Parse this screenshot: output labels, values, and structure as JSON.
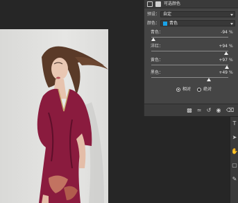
{
  "panel": {
    "title": "可选颜色",
    "preset_label": "预设：",
    "preset_value": "自定",
    "colors_label": "颜色：",
    "colors_value": "青色",
    "colors_swatch": "#1aa3e8"
  },
  "sliders": [
    {
      "label": "青色：",
      "value": "-94",
      "unit": "%",
      "level": -94
    },
    {
      "label": "洋红：",
      "value": "+94",
      "unit": "%",
      "level": 94
    },
    {
      "label": "黄色：",
      "value": "+97",
      "unit": "%",
      "level": 97
    },
    {
      "label": "黑色：",
      "value": "+49",
      "unit": "%",
      "level": 49
    }
  ],
  "method": {
    "relative_label": "相对",
    "absolute_label": "绝对",
    "selected": "relative"
  },
  "footer_icons": [
    "clip-to-layer-icon",
    "eye-previous-icon",
    "reset-icon",
    "visibility-icon",
    "trash-icon"
  ],
  "tool_icons": [
    "text-tool-icon",
    "arrow-select-icon",
    "hand-tool-icon",
    "rectangle-tool-icon",
    "edit-tool-icon"
  ],
  "colors": {
    "panel_bg": "#454545",
    "canvas_bg": "#262626",
    "photo_bg": "#e1e1df",
    "dress": "#8a1b3e"
  }
}
